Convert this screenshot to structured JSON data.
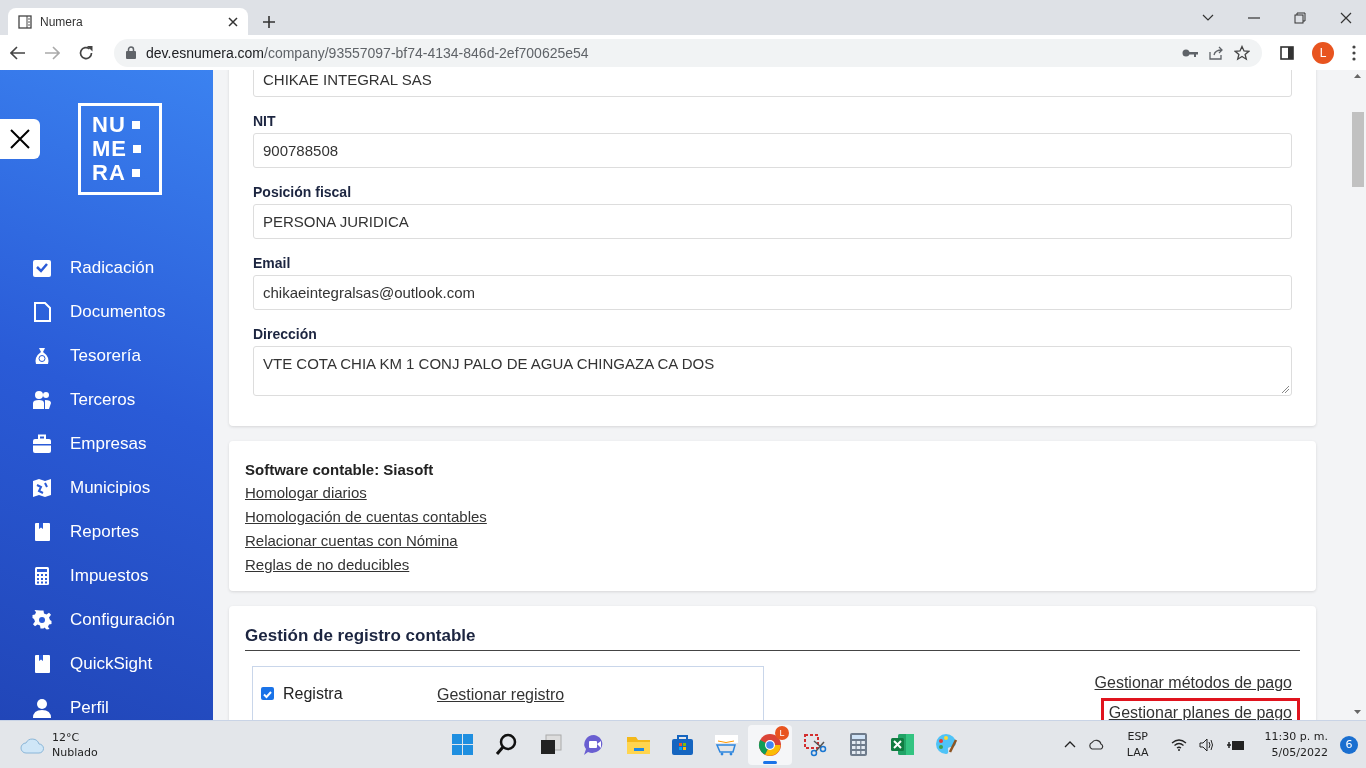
{
  "browser": {
    "tab_title": "Numera",
    "url_host": "dev.esnumera.com",
    "url_path": "/company/93557097-bf74-4134-846d-2ef700625e54",
    "avatar": "L"
  },
  "sidebar": {
    "logo": [
      "NU",
      "ME",
      "RA"
    ],
    "items": [
      {
        "label": "Radicación"
      },
      {
        "label": "Documentos"
      },
      {
        "label": "Tesorería"
      },
      {
        "label": "Terceros"
      },
      {
        "label": "Empresas"
      },
      {
        "label": "Municipios"
      },
      {
        "label": "Reportes"
      },
      {
        "label": "Impuestos"
      },
      {
        "label": "Configuración"
      },
      {
        "label": "QuickSight"
      },
      {
        "label": "Perfil"
      }
    ]
  },
  "company_form": {
    "fields": [
      {
        "kind": "input",
        "value": "CHIKAE INTEGRAL SAS"
      },
      {
        "kind": "input",
        "label": "NIT",
        "value": "900788508"
      },
      {
        "kind": "input",
        "label": "Posición fiscal",
        "value": "PERSONA JURIDICA"
      },
      {
        "kind": "input",
        "label": "Email",
        "value": "chikaeintegralsas@outlook.com"
      },
      {
        "kind": "textarea",
        "label": "Dirección",
        "value": "VTE COTA CHIA KM 1 CONJ PALO DE AGUA CHINGAZA CA DOS"
      }
    ]
  },
  "software_card": {
    "title": "Software contable: Siasoft",
    "links": [
      "Homologar diarios",
      "Homologación de cuentas contables",
      "Relacionar cuentas con Nómina",
      "Reglas de no deducibles"
    ]
  },
  "registro_card": {
    "title": "Gestión de registro contable",
    "options": [
      {
        "label": "Registra",
        "checked": true,
        "link": "Gestionar registro"
      }
    ],
    "links": [
      {
        "text": "Gestionar métodos de pago",
        "highlighted": false
      },
      {
        "text": "Gestionar planes de pago",
        "highlighted": true
      }
    ]
  },
  "taskbar": {
    "weather": {
      "temperature": "12°C",
      "condition": "Nublado"
    },
    "apps": [
      {
        "kind": "start",
        "active": false
      },
      {
        "kind": "search",
        "active": false
      },
      {
        "kind": "taskview",
        "active": false
      },
      {
        "kind": "chat",
        "active": false
      },
      {
        "kind": "explorer",
        "active": false
      },
      {
        "kind": "store",
        "active": false
      },
      {
        "kind": "amazon",
        "active": false
      },
      {
        "kind": "chrome",
        "active": true,
        "badge": "L"
      },
      {
        "kind": "snip",
        "active": false
      },
      {
        "kind": "calculator",
        "active": false
      },
      {
        "kind": "excel",
        "active": false
      },
      {
        "kind": "paint",
        "active": false
      }
    ],
    "language": [
      "ESP",
      "LAA"
    ],
    "time": "11:30 p. m.",
    "date": "5/05/2022",
    "notifications": "6"
  }
}
